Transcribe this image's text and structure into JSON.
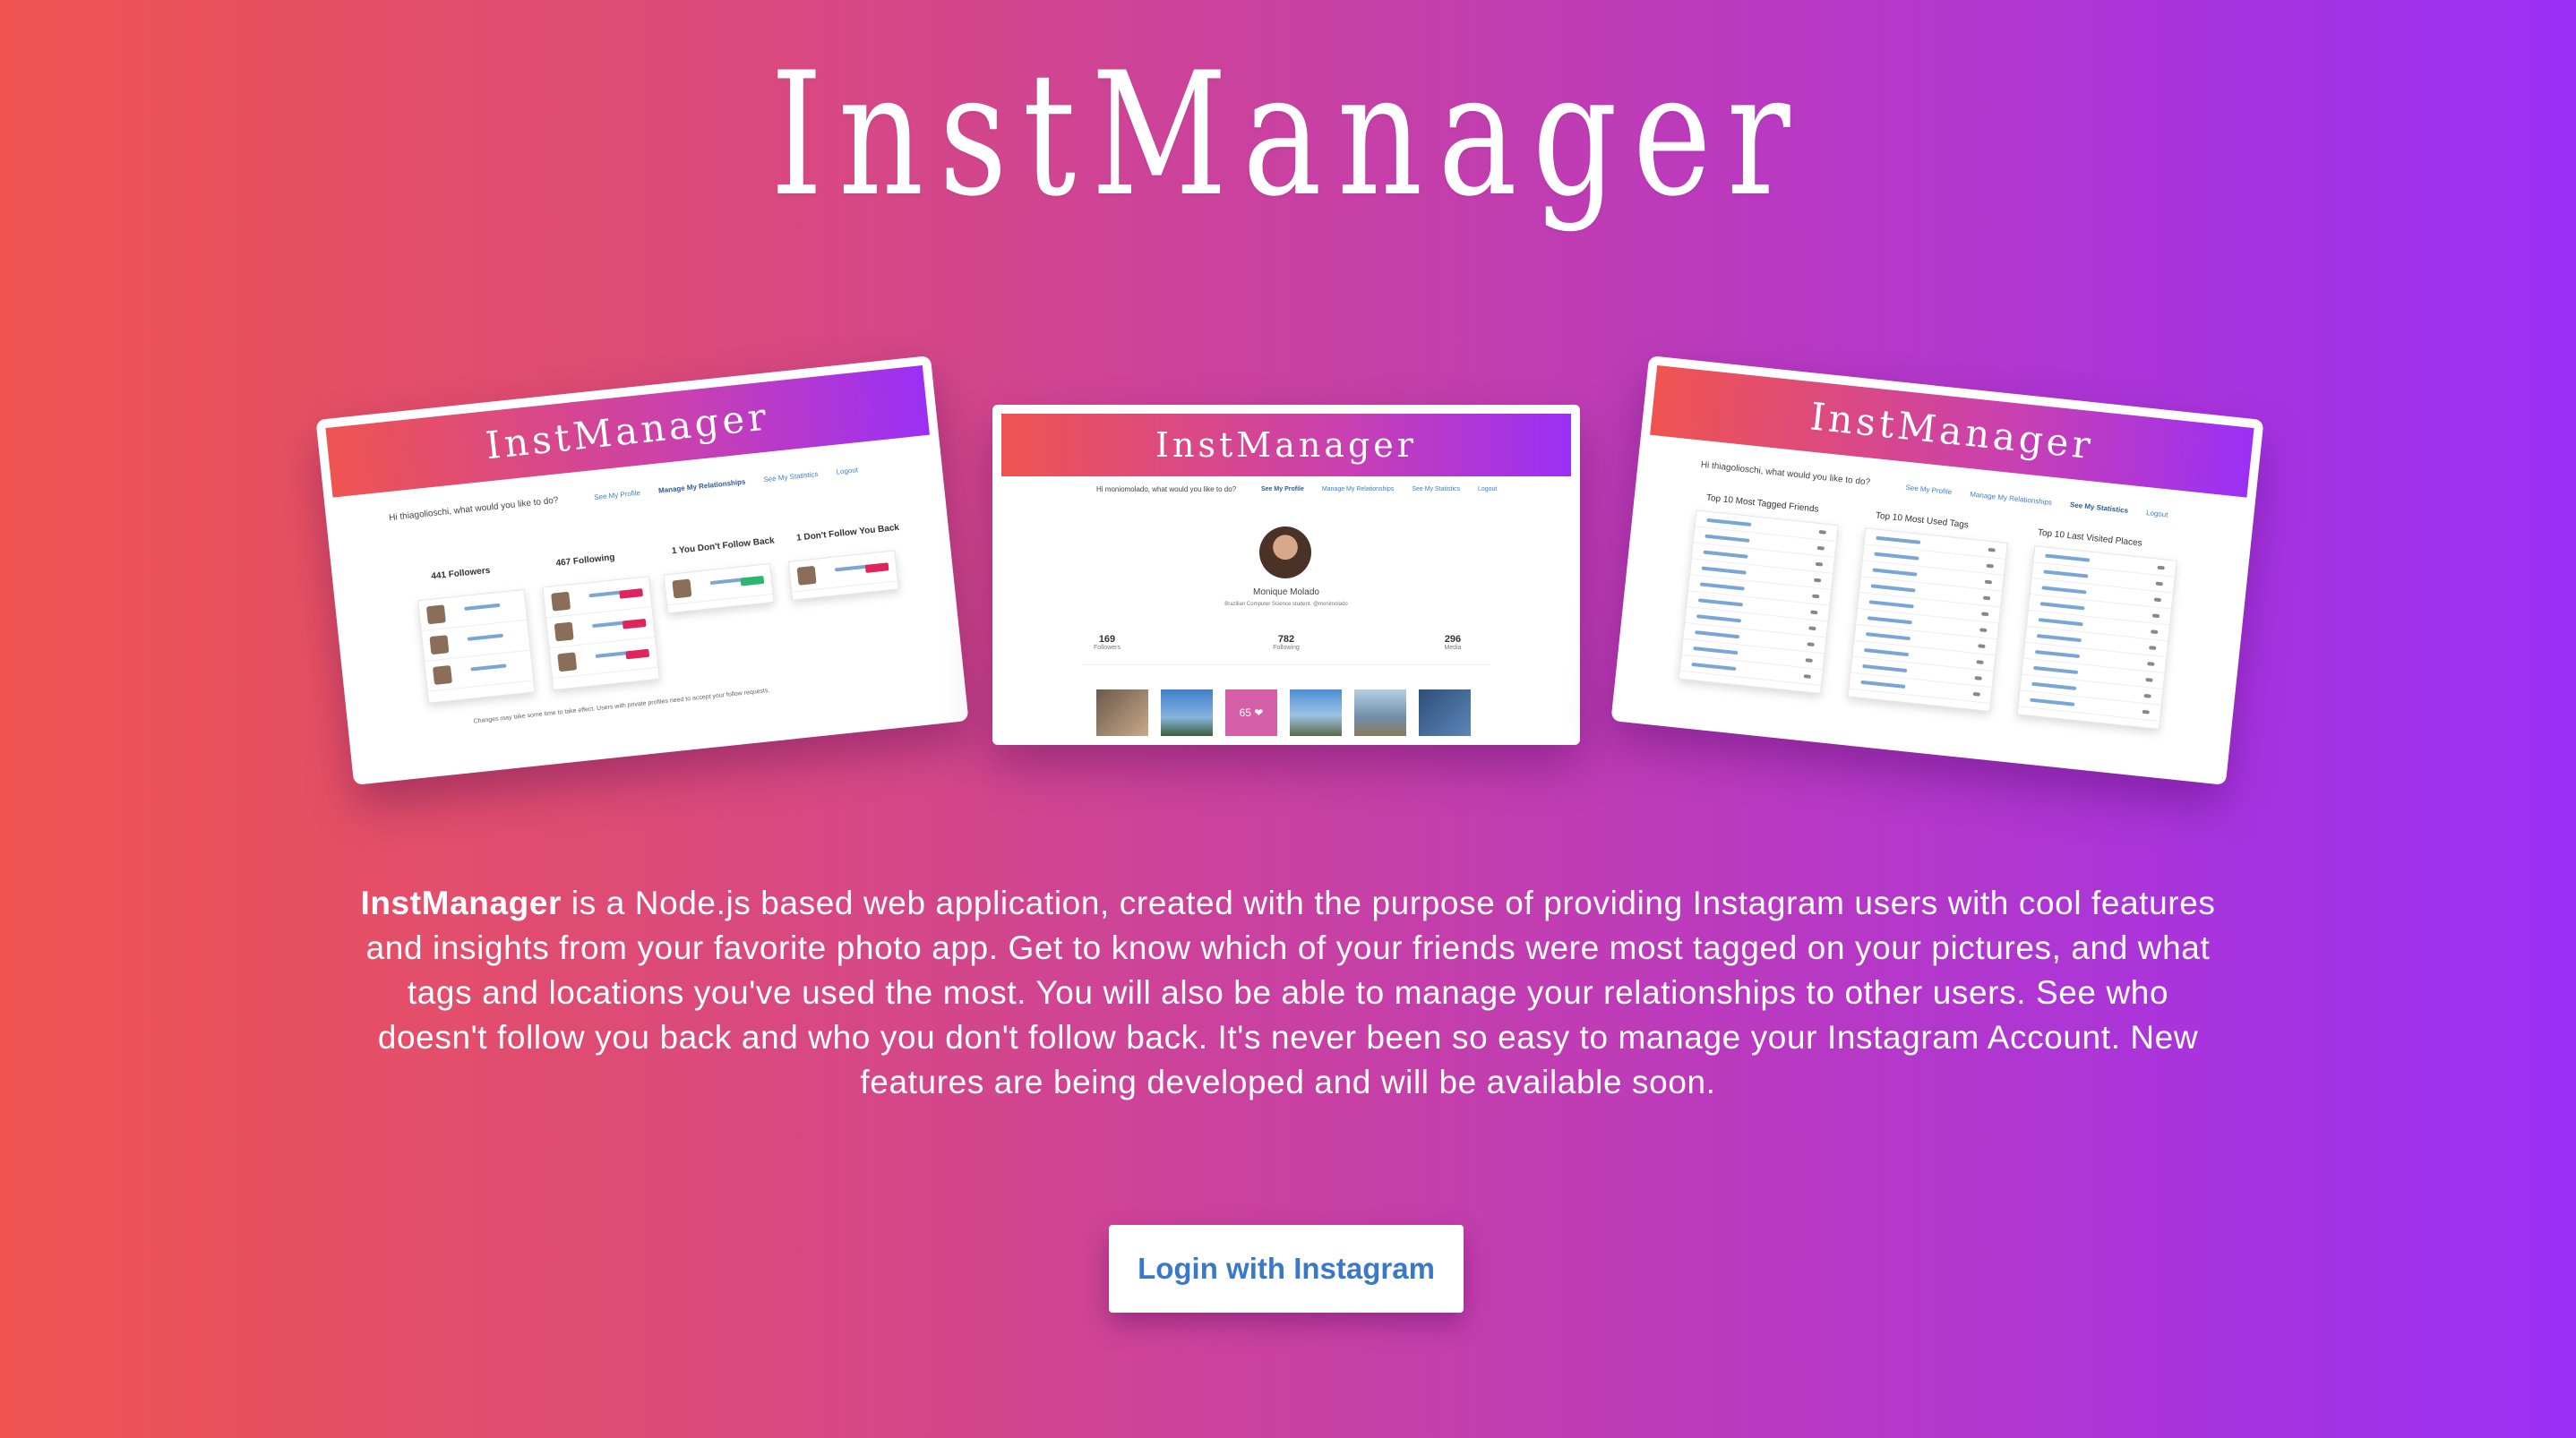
{
  "app": {
    "title": "InstManager"
  },
  "screens": [
    {
      "brand": "InstManager",
      "greeting": "Hi thiagolioschi, what would you like to do?",
      "nav": [
        "See My Profile",
        "Manage My Relationships",
        "See My Statistics",
        "Logout"
      ],
      "columns": [
        "441 Followers",
        "467 Following",
        "1 You Don't Follow Back",
        "1 Don't Follow You Back"
      ],
      "footnote": "Changes may take some time to take effect. Users with private profiles need to accept your follow requests."
    },
    {
      "brand": "InstManager",
      "greeting": "Hi moniomolado, what would you like to do?",
      "nav": [
        "See My Profile",
        "Manage My Relationships",
        "See My Statistics",
        "Logout"
      ],
      "profile_name": "Monique Molado",
      "profile_bio": "Brazilian Computer Science student. @monimolado",
      "stats": [
        {
          "value": "169",
          "label": "Followers"
        },
        {
          "value": "782",
          "label": "Following"
        },
        {
          "value": "296",
          "label": "Media"
        }
      ],
      "like_badge": "65 ❤"
    },
    {
      "brand": "InstManager",
      "greeting": "Hi thiagolioschi, what would you like to do?",
      "nav": [
        "See My Profile",
        "Manage My Relationships",
        "See My Statistics",
        "Logout"
      ],
      "columns": [
        "Top 10 Most Tagged Friends",
        "Top 10 Most Used Tags",
        "Top 10 Last Visited Places"
      ]
    }
  ],
  "description": {
    "strong": "InstManager",
    "text": " is a Node.js based web application, created with the purpose of providing Instagram users with cool features and insights from your favorite photo app. Get to know which of your friends were most tagged on your pictures, and what tags and locations you've used the most. You will also be able to manage your relationships to other users. See who doesn't follow you back and who you don't follow back. It's never been so easy to manage your Instagram Account. New features are being developed and will be available soon."
  },
  "login_button": "Login with Instagram",
  "colors": {
    "gradient_start": "#ef5450",
    "gradient_end": "#9b2ff5",
    "link": "#3a78c9"
  }
}
